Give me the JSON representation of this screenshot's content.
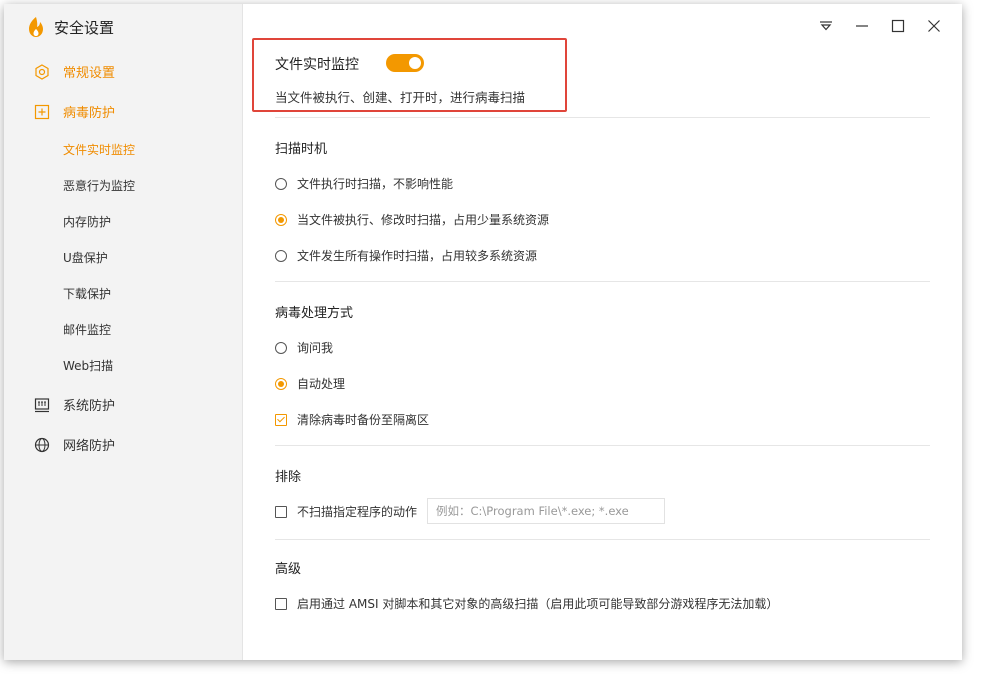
{
  "app": {
    "title": "安全设置",
    "brand_color": "#f39800"
  },
  "sidebar": {
    "items": [
      {
        "label": "常规设置",
        "icon": "gear-icon"
      },
      {
        "label": "病毒防护",
        "icon": "plus-box-icon"
      },
      {
        "label": "系统防护",
        "icon": "system-monitor-icon"
      },
      {
        "label": "网络防护",
        "icon": "globe-icon"
      }
    ],
    "sub_items": [
      "文件实时监控",
      "恶意行为监控",
      "内存防护",
      "U盘保护",
      "下载保护",
      "邮件监控",
      "Web扫描"
    ]
  },
  "window_controls": [
    "menu-icon",
    "minimize-icon",
    "maximize-icon",
    "close-icon"
  ],
  "realtime": {
    "title": "文件实时监控",
    "enabled": true,
    "description": "当文件被执行、创建、打开时，进行病毒扫描"
  },
  "scan_timing": {
    "title": "扫描时机",
    "options": [
      {
        "label": "文件执行时扫描，不影响性能",
        "selected": false
      },
      {
        "label": "当文件被执行、修改时扫描，占用少量系统资源",
        "selected": true
      },
      {
        "label": "文件发生所有操作时扫描，占用较多系统资源",
        "selected": false
      }
    ]
  },
  "virus_handling": {
    "title": "病毒处理方式",
    "options": [
      {
        "label": "询问我",
        "selected": false
      },
      {
        "label": "自动处理",
        "selected": true
      }
    ],
    "backup_label": "清除病毒时备份至隔离区",
    "backup_checked": true
  },
  "exclude": {
    "title": "排除",
    "checkbox_label": "不扫描指定程序的动作",
    "checked": false,
    "placeholder": "例如：C:\\Program File\\*.exe; *.exe"
  },
  "advanced": {
    "title": "高级",
    "checkbox_label": "启用通过 AMSI 对脚本和其它对象的高级扫描（启用此项可能导致部分游戏程序无法加载）",
    "checked": false
  }
}
